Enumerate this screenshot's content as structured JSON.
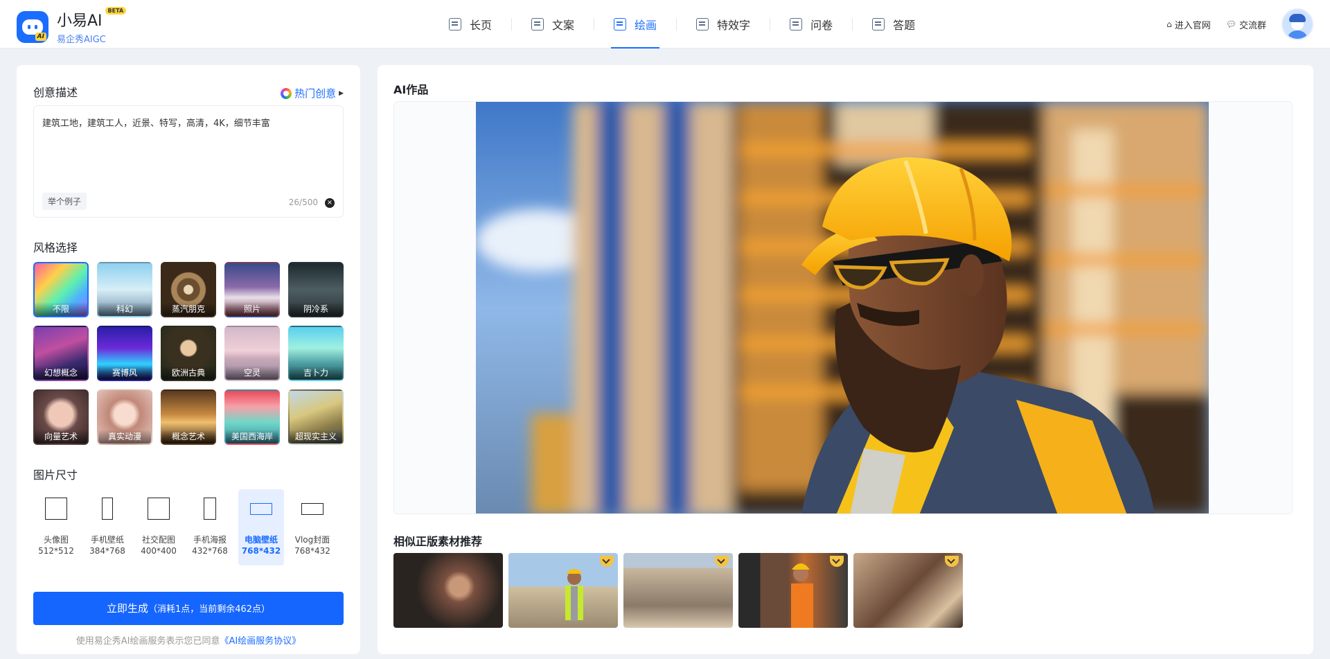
{
  "header": {
    "logo_title": "小易AI",
    "beta": "BETA",
    "logo_sub": "易企秀AIGC",
    "logo_badge": "AI",
    "nav": [
      {
        "label": "长页",
        "icon": "long-page-icon"
      },
      {
        "label": "文案",
        "icon": "copywriting-icon"
      },
      {
        "label": "绘画",
        "icon": "painting-icon",
        "active": true
      },
      {
        "label": "特效字",
        "icon": "effect-text-icon"
      },
      {
        "label": "问卷",
        "icon": "survey-icon"
      },
      {
        "label": "答题",
        "icon": "quiz-icon"
      }
    ],
    "links": [
      {
        "label": "进入官网",
        "icon": "home-icon"
      },
      {
        "label": "交流群",
        "icon": "chat-icon"
      }
    ]
  },
  "left": {
    "prompt_title": "创意描述",
    "hot_label": "热门创意",
    "prompt_value": "建筑工地，建筑工人，近景、特写，高清，4K，细节丰富",
    "example_label": "举个例子",
    "counter": "26/500",
    "style_title": "风格选择",
    "styles": [
      {
        "label": "不限",
        "selected": true
      },
      {
        "label": "科幻"
      },
      {
        "label": "蒸汽朋克"
      },
      {
        "label": "照片"
      },
      {
        "label": "阴冷系"
      },
      {
        "label": "幻想概念"
      },
      {
        "label": "赛博风"
      },
      {
        "label": "欧洲古典"
      },
      {
        "label": "空灵"
      },
      {
        "label": "吉卜力"
      },
      {
        "label": "向量艺术"
      },
      {
        "label": "真实动漫"
      },
      {
        "label": "概念艺术"
      },
      {
        "label": "美国西海岸"
      },
      {
        "label": "超现实主义"
      }
    ],
    "size_title": "图片尺寸",
    "sizes": [
      {
        "name": "头像图",
        "dim": "512*512"
      },
      {
        "name": "手机壁纸",
        "dim": "384*768"
      },
      {
        "name": "社交配图",
        "dim": "400*400"
      },
      {
        "name": "手机海报",
        "dim": "432*768"
      },
      {
        "name": "电脑壁纸",
        "dim": "768*432",
        "selected": true
      },
      {
        "name": "Vlog封面",
        "dim": "768*432"
      }
    ],
    "generate_label": "立即生成",
    "generate_note": "（消耗1点，当前剩余462点）",
    "agree_text": "使用易企秀AI绘画服务表示您已同意",
    "agree_link": "《AI绘画服务协议》"
  },
  "right": {
    "title": "AI作品",
    "similar_title": "相似正版素材推荐"
  },
  "colors": {
    "accent": "#1a6dff",
    "button": "#1565ff",
    "background": "#eef1f6",
    "premium": "#f5c242"
  }
}
